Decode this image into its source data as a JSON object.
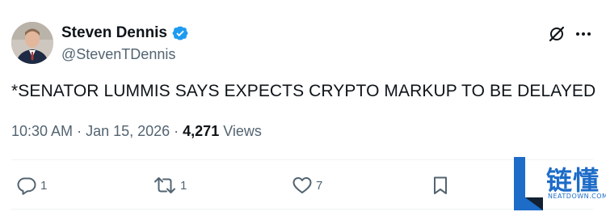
{
  "author": {
    "display_name": "Steven Dennis",
    "handle": "@StevenTDennis"
  },
  "tweet": {
    "text": "*SENATOR LUMMIS SAYS EXPECTS CRYPTO MARKUP TO BE DELAYED",
    "time": "10:30 AM",
    "separator1": " · ",
    "date": "Jan 15, 2026",
    "separator2": " · ",
    "views_count": "4,271",
    "views_label": " Views"
  },
  "actions": {
    "reply_count": "1",
    "retweet_count": "1",
    "like_count": "7"
  },
  "watermark": {
    "chinese": "链懂",
    "site": "NEATDOWN.COM"
  },
  "colors": {
    "verified": "#1d9bf0",
    "secondary_text": "#536471",
    "primary_text": "#0f1419",
    "watermark": "#1d6cc8"
  },
  "icons": [
    "verified-badge-icon",
    "grok-icon",
    "more-icon",
    "reply-icon",
    "retweet-icon",
    "like-icon",
    "bookmark-icon"
  ]
}
